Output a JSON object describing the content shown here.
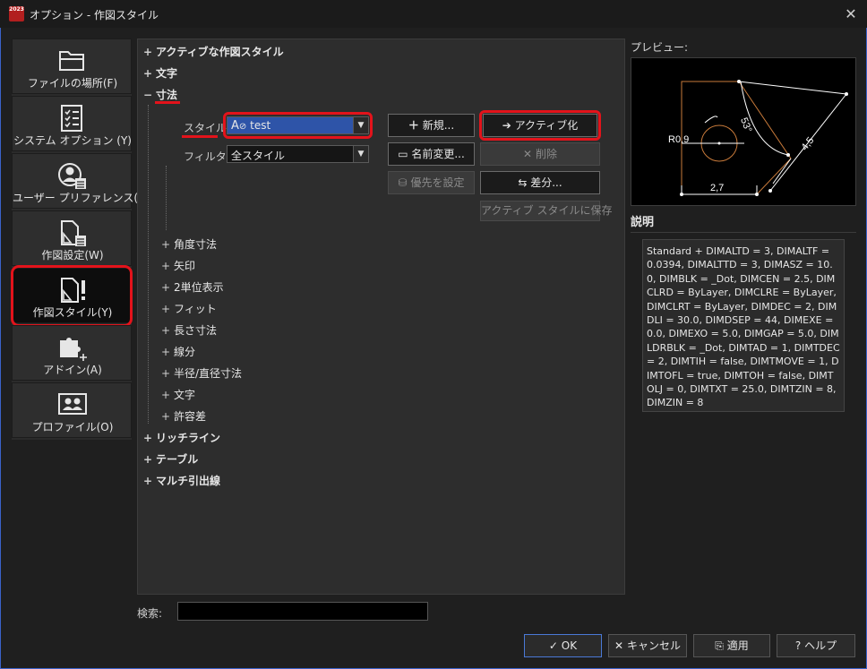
{
  "window": {
    "title": "オプション - 作図スタイル",
    "app_icon_text": "2023"
  },
  "sidebar": {
    "items": [
      {
        "label": "ファイルの場所(F)",
        "icon": "folder-icon"
      },
      {
        "label": "システム オプション (Y)",
        "icon": "checklist-icon"
      },
      {
        "label": "ユーザー プリファレンス(U)",
        "icon": "user-prefs-icon"
      },
      {
        "label": "作図設定(W)",
        "icon": "drawing-settings-icon"
      },
      {
        "label": "作図スタイル(Y)",
        "icon": "drafting-style-icon",
        "active": true
      },
      {
        "label": "アドイン(A)",
        "icon": "puzzle-icon"
      },
      {
        "label": "プロファイル(O)",
        "icon": "profile-icon"
      }
    ]
  },
  "tree": {
    "top": [
      "アクティブな作図スタイル",
      "文字",
      "寸法"
    ],
    "dimension_children": [
      "角度寸法",
      "矢印",
      "2単位表示",
      "フィット",
      "長さ寸法",
      "線分",
      "半径/直径寸法",
      "文字",
      "許容差"
    ],
    "bottom": [
      "リッチライン",
      "テーブル",
      "マルチ引出線"
    ],
    "expanded_symbol": "−",
    "collapsed_symbol": "+"
  },
  "style_form": {
    "style_label": "スタイル:",
    "style_value": "test",
    "filter_label": "フィルタ:",
    "filter_value": "全スタイル"
  },
  "buttons": {
    "new": "新規...",
    "activate": "アクティブ化",
    "rename": "名前変更...",
    "delete": "削除",
    "priority": "優先を設定",
    "diff": "差分...",
    "save_to_active": "アクティブ スタイルに保存"
  },
  "preview": {
    "label": "プレビュー:",
    "dims": {
      "radius": "R0,9",
      "angle": "53°",
      "aligned": "4,5",
      "linear": "2,7"
    }
  },
  "description": {
    "title": "説明",
    "text": "Standard + DIMALTD = 3, DIMALTF = 0.0394, DIMALTTD = 3, DIMASZ = 10.0, DIMBLK = _Dot, DIMCEN = 2.5, DIMCLRD = ByLayer, DIMCLRE = ByLayer, DIMCLRT = ByLayer, DIMDEC = 2, DIMDLI = 30.0, DIMDSEP = 44, DIMEXE = 0.0, DIMEXO = 5.0, DIMGAP = 5.0, DIMLDRBLK = _Dot, DIMTAD = 1, DIMTDEC = 2, DIMTIH = false, DIMTMOVE = 1, DIMTOFL = true, DIMTOH = false, DIMTOLJ = 0, DIMTXT = 25.0, DIMTZIN = 8, DIMZIN = 8"
  },
  "search": {
    "label": "検索:",
    "value": ""
  },
  "footer": {
    "ok": "OK",
    "cancel": "キャンセル",
    "apply": "適用",
    "help": "ヘルプ"
  },
  "colors": {
    "highlight": "#e3131b",
    "selection": "#2e54a8",
    "preview_shape": "#c87a3a"
  }
}
